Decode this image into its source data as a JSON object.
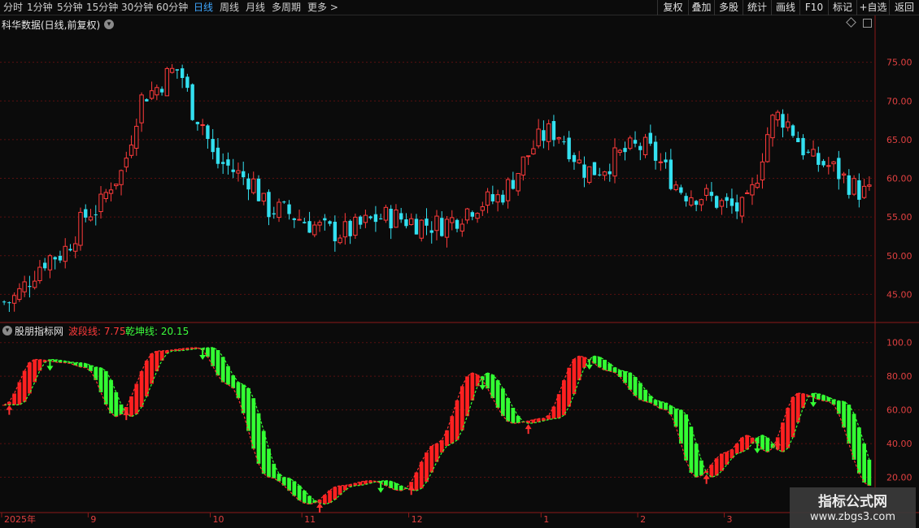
{
  "toolbar": {
    "periods": [
      "分时",
      "1分钟",
      "5分钟",
      "15分钟",
      "30分钟",
      "60分钟",
      "日线",
      "周线",
      "月线",
      "多周期",
      "更多 >"
    ],
    "active_period": "日线",
    "right_buttons": [
      "复权",
      "叠加",
      "多股",
      "统计",
      "画线",
      "F10",
      "标记",
      "+自选",
      "返回"
    ]
  },
  "main_chart": {
    "title": "科华数据(日线,前复权)",
    "price_axis": [
      "75.00",
      "70.00",
      "65.00",
      "60.00",
      "55.00",
      "50.00",
      "45.00"
    ]
  },
  "indicator": {
    "name": "股朋指标网",
    "line1_label": "波段线: 7.75",
    "line2_label": "乾坤线: 20.15",
    "axis": [
      "100.0",
      "80.00",
      "60.00",
      "40.00",
      "20.00"
    ]
  },
  "time_axis": [
    "2025年",
    "9",
    "10",
    "11",
    "12",
    "1",
    "2",
    "3"
  ],
  "watermark": {
    "title": "指标公式网",
    "url": "www.zbgs3.com"
  },
  "colors": {
    "up": "#ff3b3b",
    "down": "#33e0f0",
    "green": "#33ff33",
    "red": "#ff2020",
    "grid": "#5a1010"
  },
  "chart_data": {
    "type": "candlestick",
    "price_close_curve": [
      [
        0,
        44
      ],
      [
        10,
        50
      ],
      [
        18,
        56
      ],
      [
        22,
        60
      ],
      [
        28,
        71
      ],
      [
        34,
        74
      ],
      [
        38,
        68
      ],
      [
        42,
        62
      ],
      [
        48,
        60
      ],
      [
        52,
        56
      ],
      [
        66,
        53
      ],
      [
        75,
        55
      ],
      [
        85,
        54
      ],
      [
        95,
        57
      ],
      [
        108,
        66
      ],
      [
        115,
        61
      ],
      [
        125,
        64
      ],
      [
        135,
        58
      ],
      [
        145,
        56
      ],
      [
        152,
        68
      ],
      [
        160,
        62
      ],
      [
        170,
        58
      ]
    ],
    "indicator_curve": [
      [
        0,
        63
      ],
      [
        6,
        90
      ],
      [
        12,
        88
      ],
      [
        16,
        85
      ],
      [
        22,
        56
      ],
      [
        30,
        95
      ],
      [
        38,
        97
      ],
      [
        44,
        75
      ],
      [
        52,
        20
      ],
      [
        60,
        4
      ],
      [
        66,
        15
      ],
      [
        72,
        18
      ],
      [
        78,
        12
      ],
      [
        85,
        40
      ],
      [
        92,
        82
      ],
      [
        100,
        52
      ],
      [
        106,
        55
      ],
      [
        113,
        92
      ],
      [
        119,
        83
      ],
      [
        126,
        65
      ],
      [
        130,
        60
      ],
      [
        136,
        20
      ],
      [
        142,
        35
      ],
      [
        146,
        45
      ],
      [
        150,
        35
      ],
      [
        156,
        70
      ],
      [
        162,
        65
      ],
      [
        170,
        15
      ]
    ],
    "ylim_price": [
      42,
      80
    ],
    "ylim_indicator": [
      0,
      110
    ]
  }
}
